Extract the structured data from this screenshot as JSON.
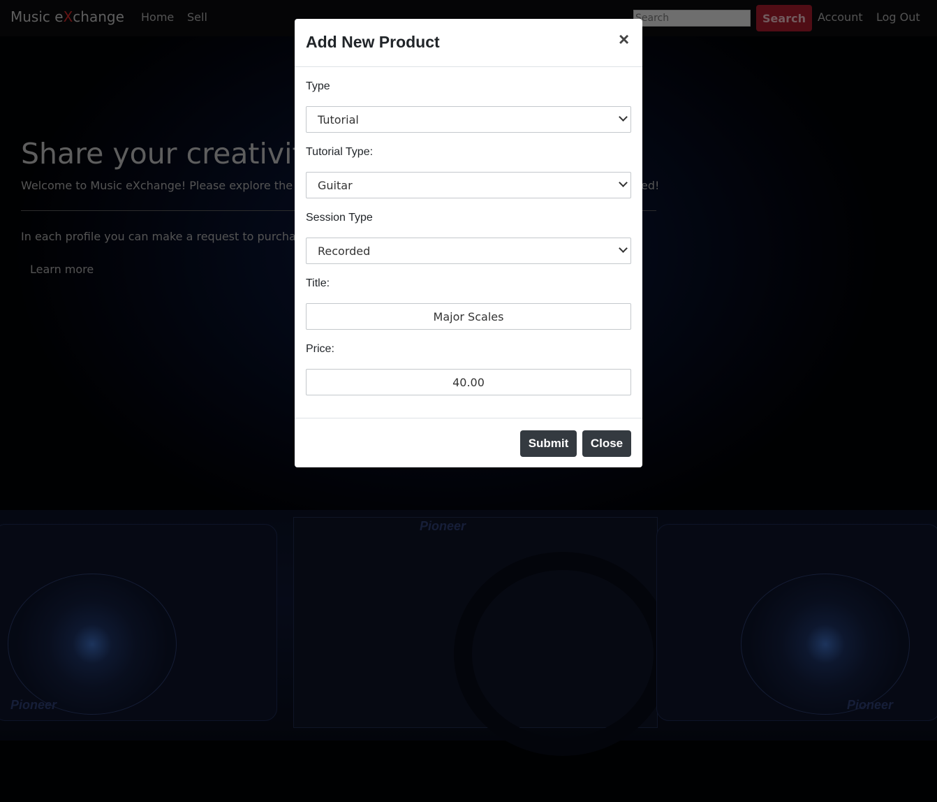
{
  "navbar": {
    "brand_prefix": "Music e",
    "brand_x": "X",
    "brand_suffix": "change",
    "links": [
      "Home",
      "Sell"
    ],
    "search_placeholder": "Search",
    "search_button": "Search",
    "account": "Account",
    "logout": "Log Out"
  },
  "hero": {
    "title": "Share your creativity",
    "subtitle_left": "Welcome to Music eXchange! Please explore the",
    "subtitle_right": "ed!",
    "text": "In each profile you can make a request to purcha",
    "learn_more": "Learn more"
  },
  "background": {
    "brand_marks": [
      "Pioneer",
      "Pioneer",
      "Pioneer"
    ]
  },
  "modal": {
    "title": "Add New Product",
    "close_symbol": "×",
    "fields": {
      "type": {
        "label": "Type",
        "value": "Tutorial"
      },
      "tutorial_type": {
        "label": "Tutorial Type:",
        "value": "Guitar"
      },
      "session_type": {
        "label": "Session Type",
        "value": "Recorded"
      },
      "title": {
        "label": "Title:",
        "value": "Major Scales"
      },
      "price": {
        "label": "Price:",
        "value": "40.00"
      }
    },
    "submit": "Submit",
    "close": "Close"
  },
  "colors": {
    "brand_accent": "#c62828",
    "search_button": "#a11a2b",
    "dark_button": "#343a40"
  }
}
